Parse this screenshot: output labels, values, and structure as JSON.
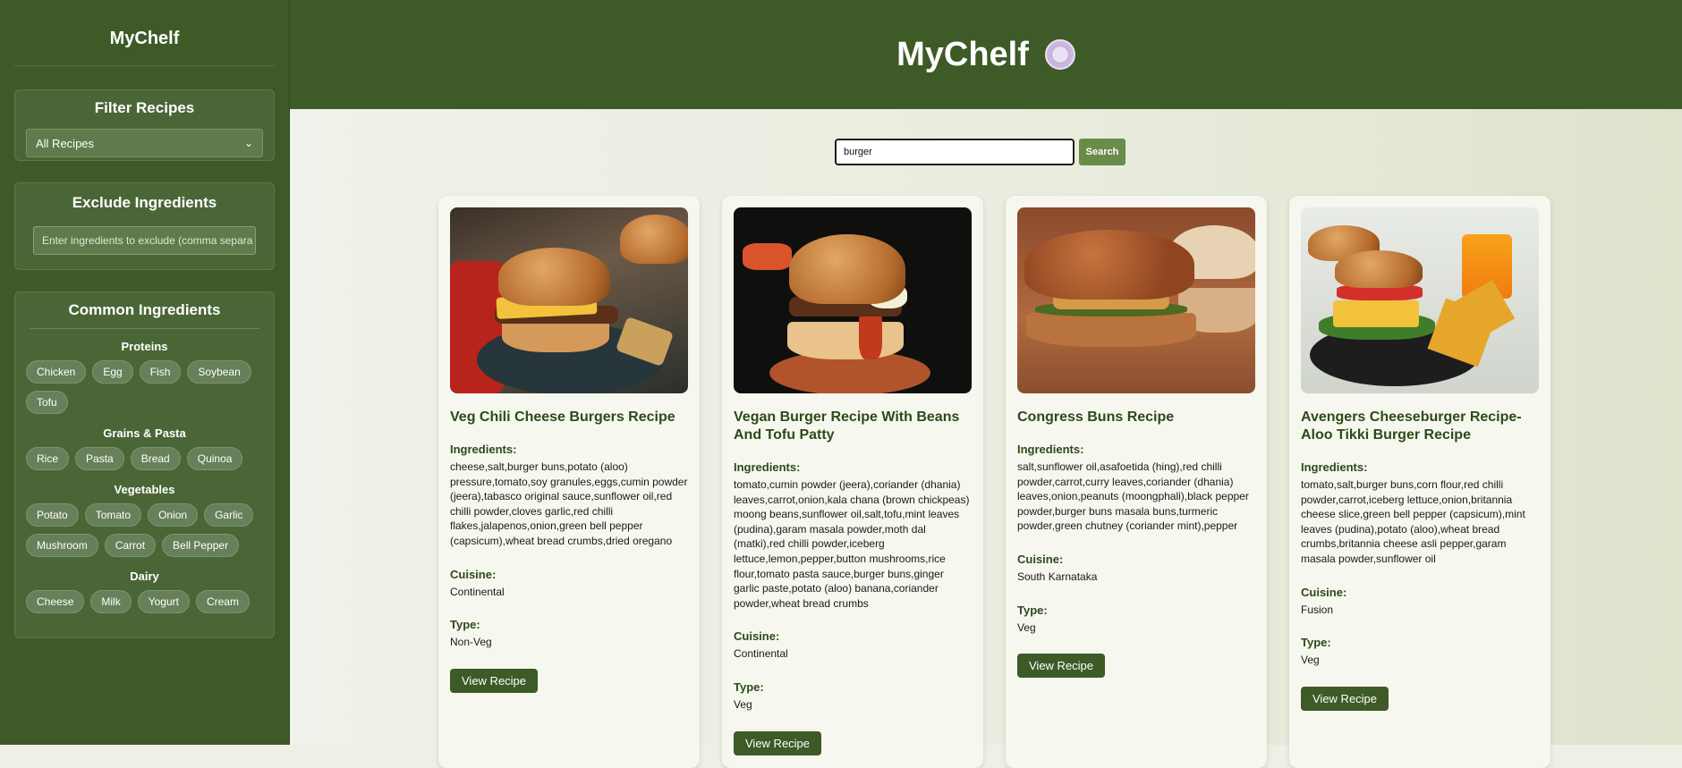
{
  "sidebar": {
    "title": "MyChelf",
    "filter": {
      "heading": "Filter Recipes",
      "selected": "All Recipes"
    },
    "exclude": {
      "heading": "Exclude Ingredients",
      "placeholder": "Enter ingredients to exclude (comma separa"
    },
    "common": {
      "heading": "Common Ingredients",
      "groups": [
        {
          "title": "Proteins",
          "items": [
            "Chicken",
            "Egg",
            "Fish",
            "Soybean",
            "Tofu"
          ]
        },
        {
          "title": "Grains & Pasta",
          "items": [
            "Rice",
            "Pasta",
            "Bread",
            "Quinoa"
          ]
        },
        {
          "title": "Vegetables",
          "items": [
            "Potato",
            "Tomato",
            "Onion",
            "Garlic",
            "Mushroom",
            "Carrot",
            "Bell Pepper"
          ]
        },
        {
          "title": "Dairy",
          "items": [
            "Cheese",
            "Milk",
            "Yogurt",
            "Cream"
          ]
        }
      ]
    }
  },
  "header": {
    "title": "MyChelf",
    "icon": "plate-icon"
  },
  "search": {
    "value": "burger",
    "button": "Search"
  },
  "labels": {
    "ingredients": "Ingredients:",
    "cuisine": "Cuisine:",
    "type": "Type:",
    "view": "View Recipe"
  },
  "recipes": [
    {
      "title": "Veg Chili Cheese Burgers Recipe",
      "ingredients": "cheese,salt,burger buns,potato (aloo) pressure,tomato,soy granules,eggs,cumin powder (jeera),tabasco original sauce,sunflower oil,red chilli powder,cloves garlic,red chilli flakes,jalapenos,onion,green bell pepper (capsicum),wheat bread crumbs,dried oregano",
      "cuisine": "Continental",
      "type": "Non-Veg"
    },
    {
      "title": "Vegan Burger Recipe With Beans And Tofu Patty",
      "ingredients": "tomato,cumin powder (jeera),coriander (dhania) leaves,carrot,onion,kala chana (brown chickpeas) moong beans,sunflower oil,salt,tofu,mint leaves (pudina),garam masala powder,moth dal (matki),red chilli powder,iceberg lettuce,lemon,pepper,button mushrooms,rice flour,tomato pasta sauce,burger buns,ginger garlic paste,potato (aloo) banana,coriander powder,wheat bread crumbs",
      "cuisine": "Continental",
      "type": "Veg"
    },
    {
      "title": "Congress Buns Recipe",
      "ingredients": "salt,sunflower oil,asafoetida (hing),red chilli powder,carrot,curry leaves,coriander (dhania) leaves,onion,peanuts (moongphali),black pepper powder,burger buns masala buns,turmeric powder,green chutney (coriander mint),pepper",
      "cuisine": "South Karnataka",
      "type": "Veg"
    },
    {
      "title": "Avengers Cheeseburger Recipe-Aloo Tikki Burger Recipe",
      "ingredients": "tomato,salt,burger buns,corn flour,red chilli powder,carrot,iceberg lettuce,onion,britannia cheese slice,green bell pepper (capsicum),mint leaves (pudina),potato (aloo),wheat bread crumbs,britannia cheese asli pepper,garam masala powder,sunflower oil",
      "cuisine": "Fusion",
      "type": "Veg"
    }
  ]
}
